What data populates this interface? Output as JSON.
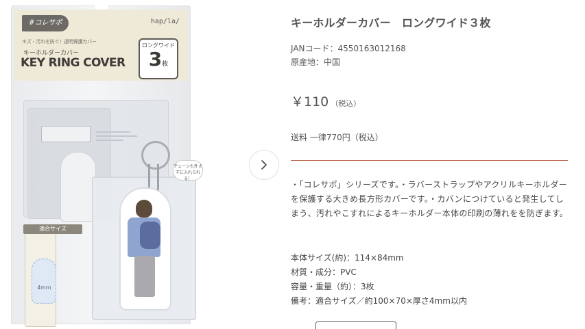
{
  "product_image": {
    "package": {
      "brand": "#コレサポ",
      "logo": "hap/la/",
      "tagline": "キズ・汚れを防ぐ！透明保護カバー",
      "subtitle": "キーホルダーカバー",
      "title": "KEY RING COVER",
      "count_label": "ロングワイド",
      "count_number": "3",
      "count_unit": "枚",
      "fit_label": "適合サイズ",
      "fit_size": "4mm",
      "sticker_text": "チェーンも外さずに入れられる！"
    }
  },
  "gallery": {
    "next_icon": "chevron-right-icon"
  },
  "product": {
    "title": "キーホルダーカバー　ロングワイド３枚",
    "jan": "JANコード：4550163012168",
    "origin": "原産地：中国",
    "price": "￥110",
    "tax_note": "（税込）",
    "shipping": "送料 一律770円（税込）",
    "description": "・「コレサポ」シリーズです。・ラバーストラップやアクリルキーホルダーを保護する大きめ長方形カバーです。・カバンにつけていると発生してしまう、汚れやこすれによるキーホルダー本体の印刷の薄れをを防ぎます。",
    "specs": [
      "本体サイズ(約)：114×84mm",
      "材質・成分：PVC",
      "容量・重量（約）：3枚",
      "備考：適合サイズ／約100×70×厚さ4mm以内"
    ]
  },
  "colors": {
    "divider": "#b6593a",
    "text": "#555555",
    "package_header": "#efe9d8"
  }
}
